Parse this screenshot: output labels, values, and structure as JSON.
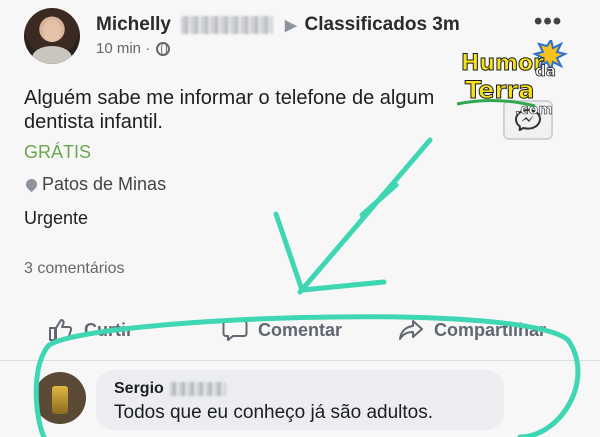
{
  "post": {
    "author": "Michelly",
    "group": "Classificados 3m",
    "time": "10 min ·",
    "text": "Alguém sabe me informar o telefone de algum dentista infantil.",
    "price": "GRÁTIS",
    "location": "Patos de Minas",
    "status": "Urgente",
    "comments_count": "3 comentários"
  },
  "actions": {
    "like": "Curtir",
    "comment": "Comentar",
    "share": "Compartilhar"
  },
  "comment": {
    "author": "Sergio",
    "text": "Todos que eu conheço já são adultos."
  },
  "watermark": {
    "line1": "Humor",
    "line2": "da",
    "line3": "Terra",
    "line4": ".com"
  },
  "colors": {
    "annotation": "#3fd6b4",
    "price": "#6aa84f"
  },
  "icons": [
    "globe-icon",
    "more-icon",
    "pin-icon",
    "messenger-icon",
    "like-icon",
    "comment-icon",
    "share-icon"
  ]
}
